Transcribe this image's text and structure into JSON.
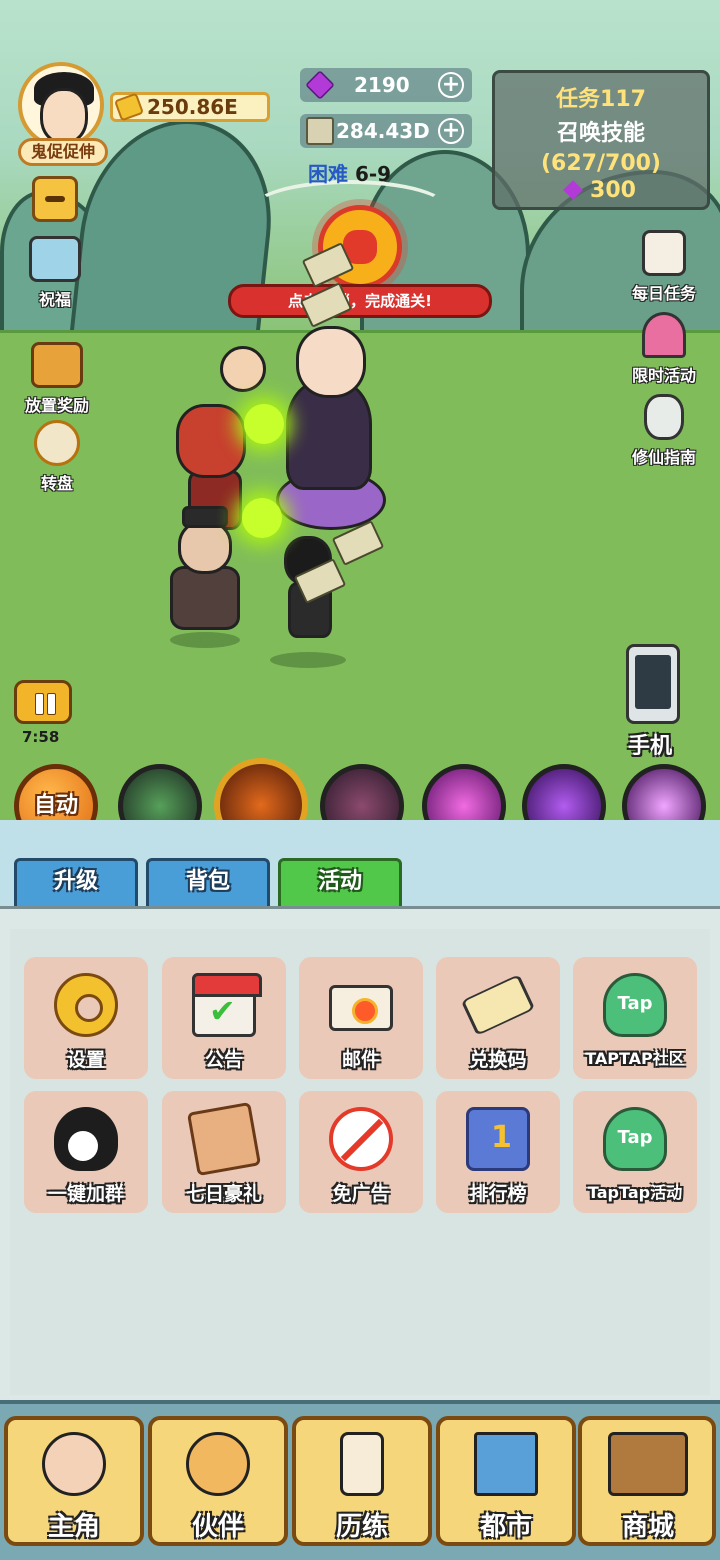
{
  "player": {
    "name": "鬼促促伸",
    "gold": "250.86E"
  },
  "resources": {
    "gems": "2190",
    "cash": "284.43D",
    "difficulty_label": "困难",
    "difficulty_stage": "6-9"
  },
  "task": {
    "title": "任务117",
    "name": "召唤技能",
    "progress": "(627/700)",
    "reward": "300"
  },
  "left_menu": {
    "blessing": "祝福",
    "idle_reward": "放置奖励",
    "wheel": "转盘"
  },
  "right_menu": {
    "daily_task": "每日任务",
    "limited_event": "限时活动",
    "guide": "修仙指南"
  },
  "battle": {
    "banner": "点击...锁，完成通关!",
    "timer": "7:58",
    "phone": "手机"
  },
  "skills": {
    "auto": "自动"
  },
  "tabs": [
    {
      "label": "升级"
    },
    {
      "label": "背包"
    },
    {
      "label": "活动"
    }
  ],
  "grid": [
    {
      "label": "设置",
      "icon": "gear-icon"
    },
    {
      "label": "公告",
      "icon": "notice-clipboard-icon"
    },
    {
      "label": "邮件",
      "icon": "mail-icon"
    },
    {
      "label": "兑换码",
      "icon": "ticket-icon"
    },
    {
      "label": "TAPTAP社区",
      "icon": "taptap-icon"
    },
    {
      "label": "一键加群",
      "icon": "qq-penguin-icon"
    },
    {
      "label": "七日豪礼",
      "icon": "scroll-calendar-icon"
    },
    {
      "label": "免广告",
      "icon": "no-ads-icon"
    },
    {
      "label": "排行榜",
      "icon": "leaderboard-icon"
    },
    {
      "label": "TapTap活动",
      "icon": "taptap-icon"
    }
  ],
  "tap_text": "Tap",
  "nav": [
    {
      "label": "主角"
    },
    {
      "label": "伙伴"
    },
    {
      "label": "历练"
    },
    {
      "label": "都市"
    },
    {
      "label": "商城"
    }
  ]
}
